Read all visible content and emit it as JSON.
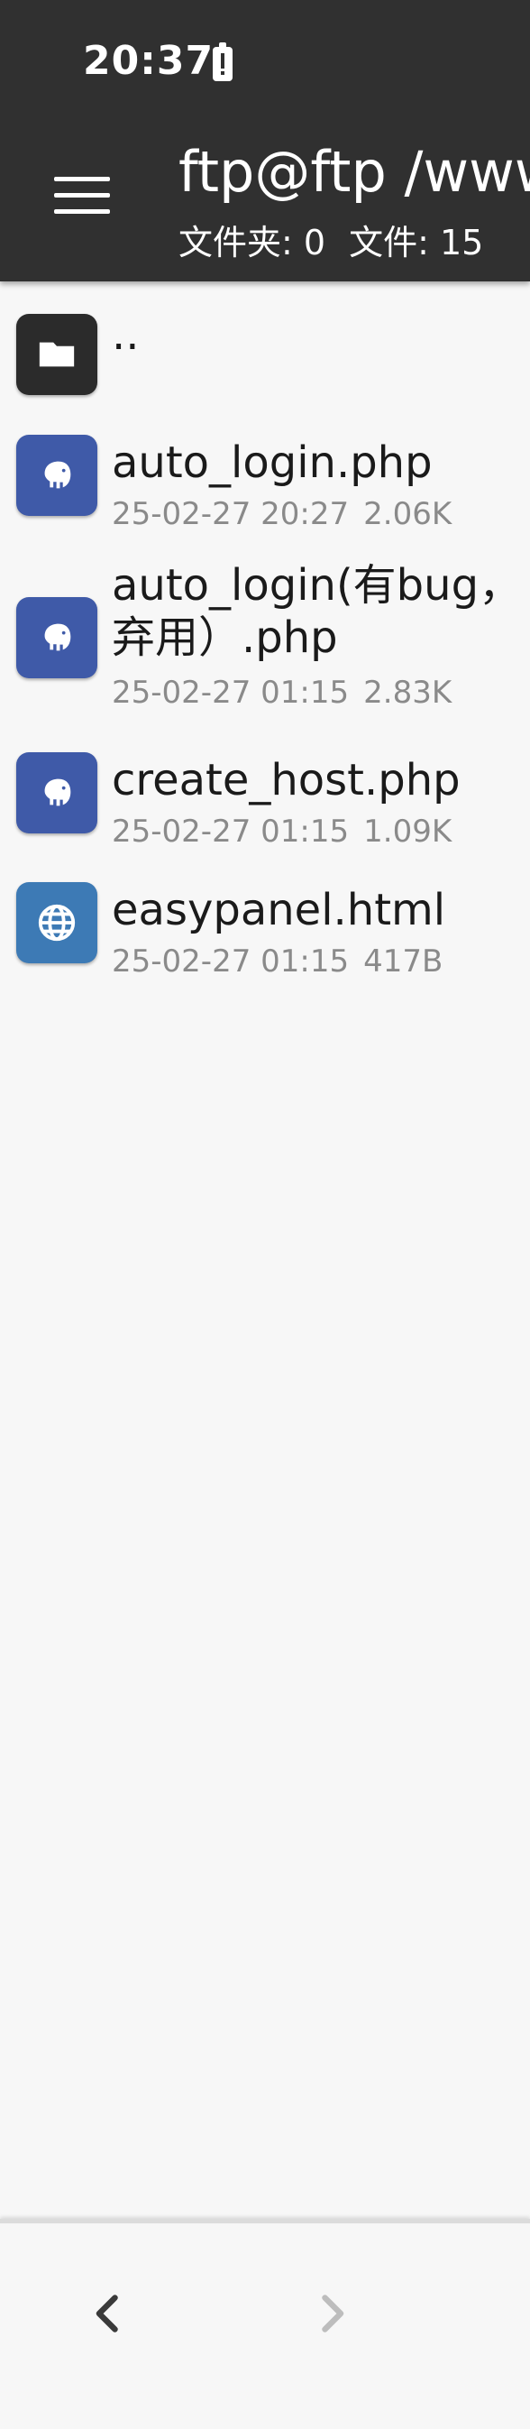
{
  "status_bar": {
    "time": "20:37",
    "battery_icon": "battery-alert-icon"
  },
  "header": {
    "menu_icon": "hamburger-menu-icon",
    "title": "ftp@ftp /www",
    "folders_label": "文件夹: 0",
    "files_label": "文件: 15"
  },
  "files": [
    {
      "name": "..",
      "date": "",
      "size": "",
      "icon": "folder-icon",
      "color": "#2b2b2b"
    },
    {
      "name": "auto_login.php",
      "date": "25-02-27 20:27",
      "size": "2.06K",
      "icon": "php-elephant-icon",
      "color": "#3f5aa8"
    },
    {
      "name": "auto_login(有bug，弃用）.php",
      "date": "25-02-27 01:15",
      "size": "2.83K",
      "icon": "php-elephant-icon",
      "color": "#3f5aa8"
    },
    {
      "name": "create_host.php",
      "date": "25-02-27 01:15",
      "size": "1.09K",
      "icon": "php-elephant-icon",
      "color": "#3f5aa8"
    },
    {
      "name": "easypanel.html",
      "date": "25-02-27 01:15",
      "size": "417B",
      "icon": "globe-icon",
      "color": "#3d7ab5"
    }
  ],
  "bottom_nav": {
    "back_icon": "chevron-left-icon",
    "forward_icon": "chevron-right-icon"
  }
}
